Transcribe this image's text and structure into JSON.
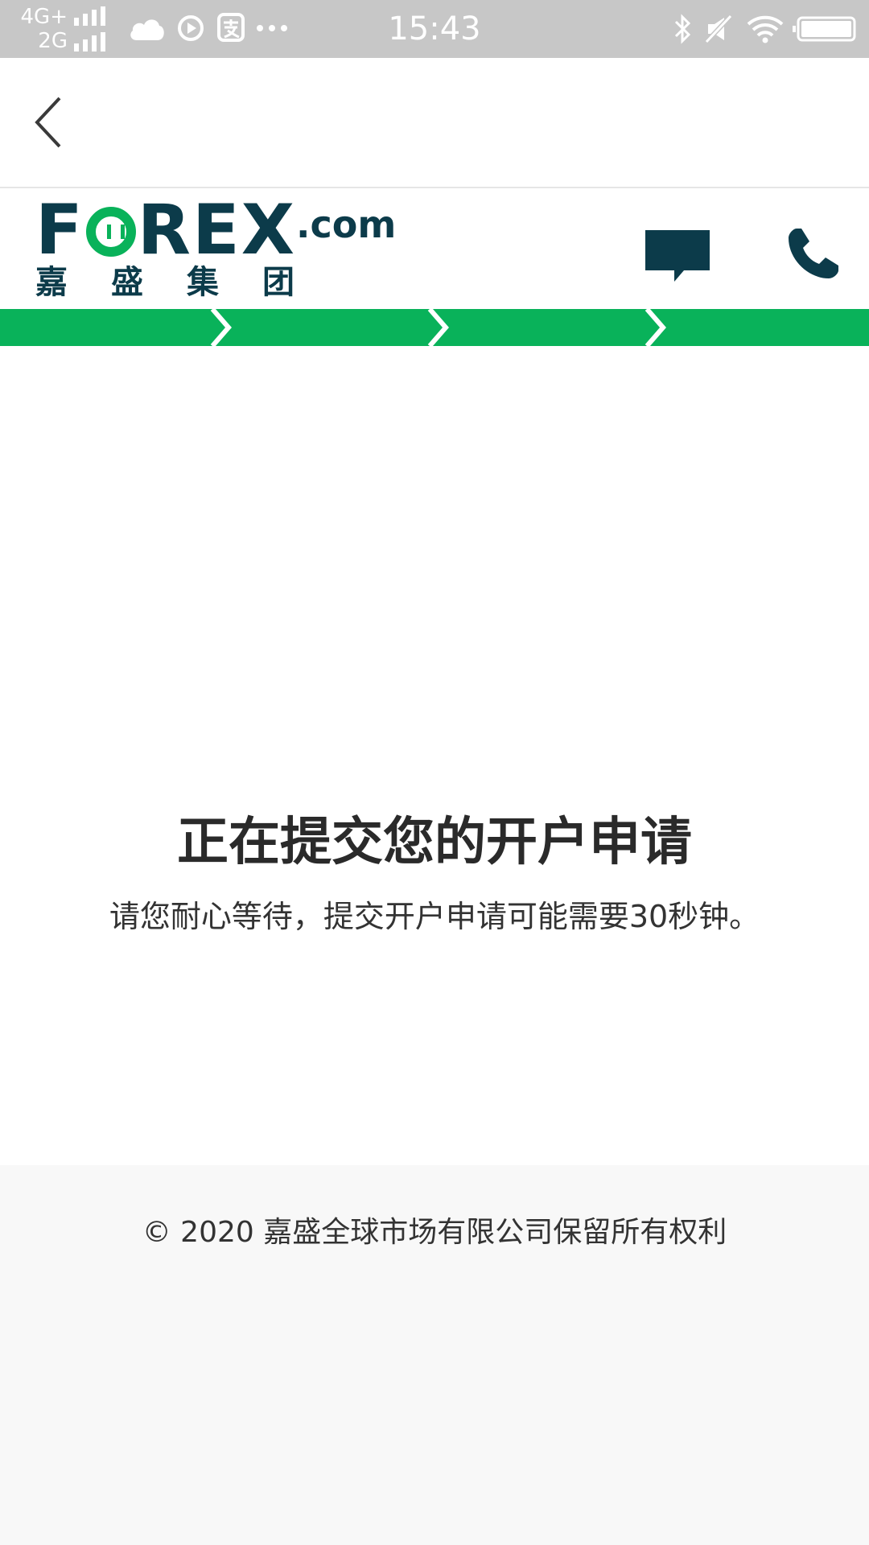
{
  "status_bar": {
    "network_primary": "4G+",
    "network_secondary": "2G",
    "time": "15:43",
    "icons_left": [
      "cloud-icon",
      "play-icon",
      "alipay-icon",
      "more-dots-icon"
    ],
    "icons_right": [
      "bluetooth-icon",
      "mute-icon",
      "wifi-icon",
      "battery-icon"
    ],
    "color": "#c7c7c7"
  },
  "nav": {
    "back_icon": "chevron-left-icon"
  },
  "brand": {
    "logo_main_1": "F",
    "logo_main_2": "REX",
    "logo_suffix": ".com",
    "logo_cn": "嘉盛集团",
    "primary_color": "#0c3b4a",
    "accent_color": "#09b25a",
    "chat_icon": "chat-bubble-icon",
    "phone_icon": "phone-icon"
  },
  "progress": {
    "steps_total": 4,
    "steps_completed": 4,
    "color": "#09b25a"
  },
  "message": {
    "title": "正在提交您的开户申请",
    "body": "请您耐心等待，提交开户申请可能需要30秒钟。"
  },
  "footer": {
    "copyright": "© 2020 嘉盛全球市场有限公司保留所有权利"
  }
}
